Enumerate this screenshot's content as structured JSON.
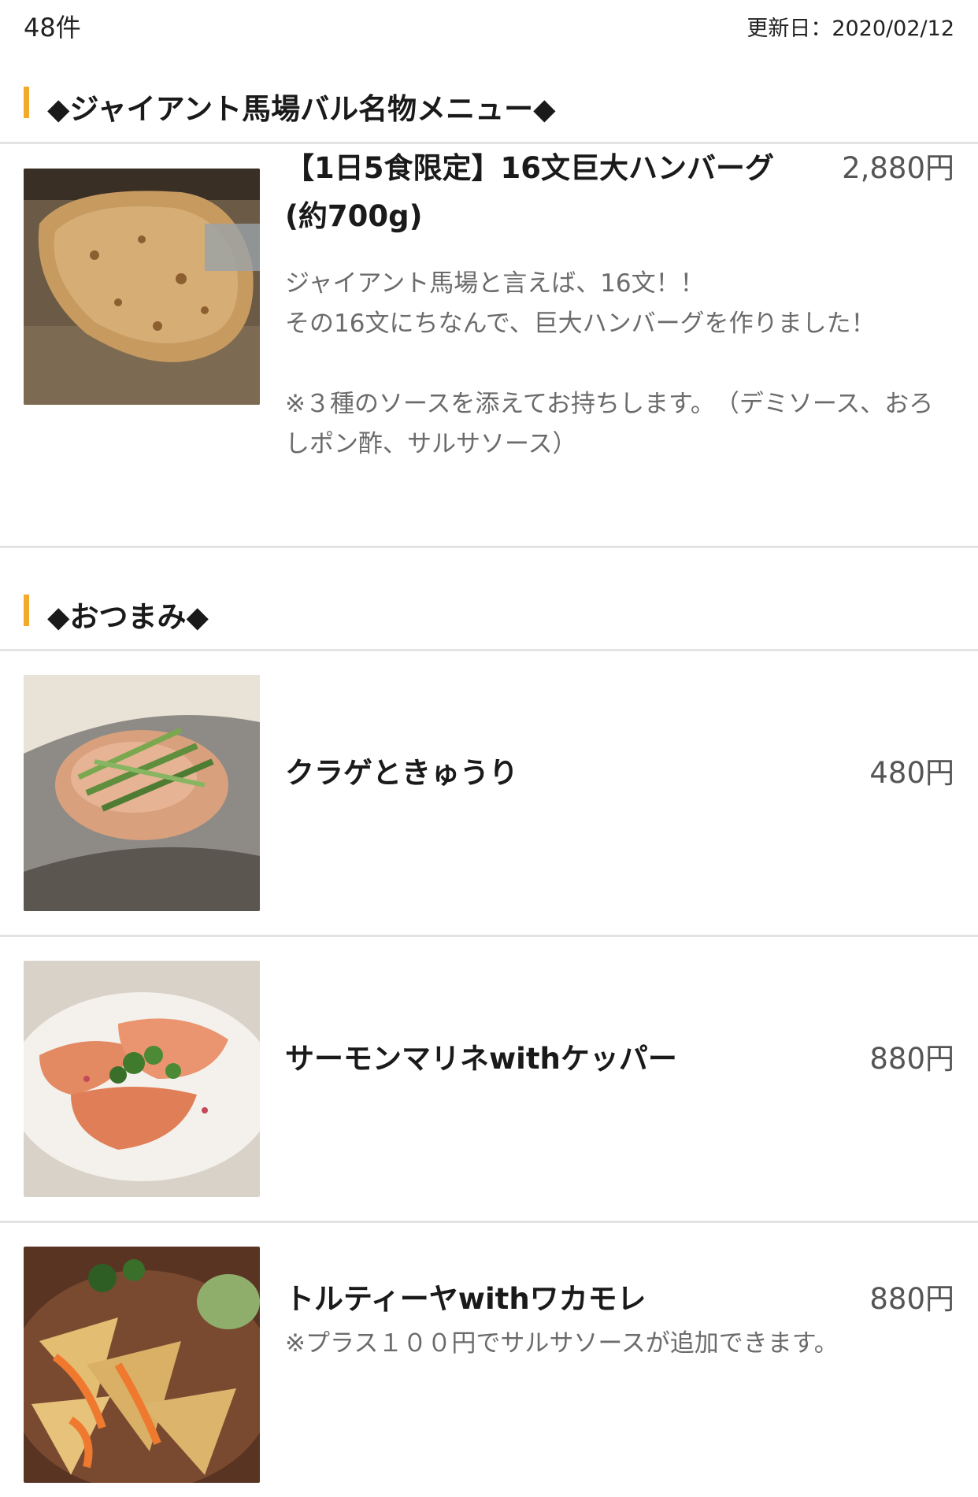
{
  "header": {
    "count": "48件",
    "updated": "更新日：2020/02/12"
  },
  "sections": [
    {
      "title": "◆ジャイアント馬場バル名物メニュー◆",
      "items": [
        {
          "name": "【1日5食限定】16文巨大ハンバーグ(約700g)",
          "price": "2,880円",
          "description": "ジャイアント馬場と言えば、16文！！\nその16文にちなんで、巨大ハンバーグを作りました！\n\n※３種のソースを添えてお持ちします。　（デミソース、おろしポン酢、サルサソース）"
        }
      ]
    },
    {
      "title": "◆おつまみ◆",
      "items": [
        {
          "name": "クラゲときゅうり",
          "price": "480円"
        },
        {
          "name": "サーモンマリネwithケッパー",
          "price": "880円"
        },
        {
          "name": "トルティーヤwithワカモレ",
          "price": "880円",
          "description": "※プラス１００円でサルサソースが追加できます。"
        }
      ]
    }
  ],
  "colors": {
    "accent": "#f2a92c",
    "divider": "#e3e3e3",
    "price": "#555555",
    "description": "#6b6b6b"
  }
}
